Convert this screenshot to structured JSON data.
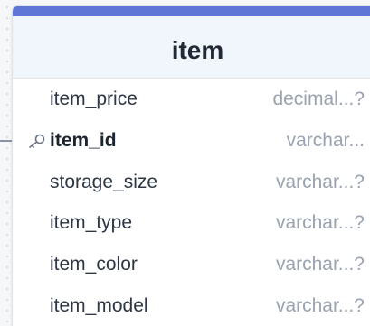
{
  "table": {
    "name": "item",
    "fields": [
      {
        "name": "item_price",
        "type": "decimal...?",
        "primary_key": false
      },
      {
        "name": "item_id",
        "type": "varchar...",
        "primary_key": true
      },
      {
        "name": "storage_size",
        "type": "varchar...?",
        "primary_key": false
      },
      {
        "name": "item_type",
        "type": "varchar...?",
        "primary_key": false
      },
      {
        "name": "item_color",
        "type": "varchar...?",
        "primary_key": false
      },
      {
        "name": "item_model",
        "type": "varchar...?",
        "primary_key": false
      }
    ]
  },
  "icons": {
    "primary_key": "key-icon"
  },
  "colors": {
    "header_accent": "#5f76d6",
    "header_background": "#f1f6fc",
    "connector_line": "#8a93a1"
  }
}
